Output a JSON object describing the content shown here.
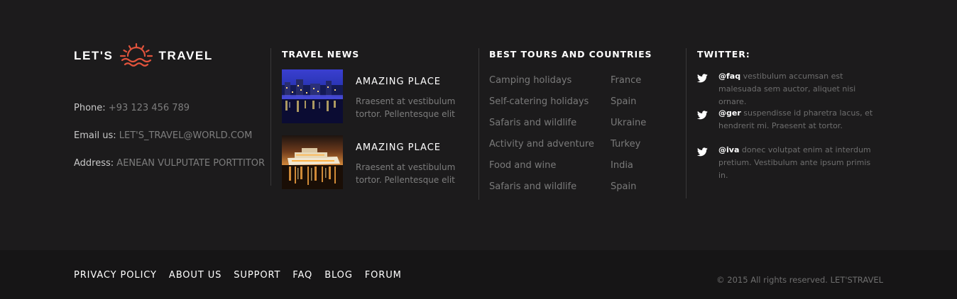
{
  "brand": {
    "left_word": "LET'S",
    "right_word": "TRAVEL",
    "logo_icon": "sun-over-waves-icon",
    "accent_color": "#e0533c"
  },
  "contact": {
    "phone_label": "Phone:",
    "phone_value": "+93 123 456 789",
    "email_label": "Email us:",
    "email_value": "LET'S_TRAVEL@WORLD.COM",
    "address_label": "Address:",
    "address_value": "AENEAN VULPUTATE PORTTITOR"
  },
  "news": {
    "title": "TRAVEL NEWS",
    "items": [
      {
        "heading": "AMAZING PLACE",
        "text": "Rraesent at vestibulum tortor. Pellentesque elit"
      },
      {
        "heading": "AMAZING PLACE",
        "text": "Rraesent at vestibulum tortor. Pellentesque elit"
      }
    ]
  },
  "tours": {
    "title": "BEST TOURS AND COUNTRIES",
    "tours": [
      "Camping holidays",
      "Self-catering holidays",
      "Safaris and wildlife",
      "Activity and adventure",
      "Food and wine",
      "Safaris and wildlife"
    ],
    "countries": [
      "France",
      "Spain",
      "Ukraine",
      "Turkey",
      "India",
      "Spain"
    ]
  },
  "twitter": {
    "title": "TWITTER:",
    "icon": "twitter-bird-icon",
    "tweets": [
      {
        "user": "@faq",
        "text": " vestibulum accumsan est malesuada sem auctor, aliquet nisi ornare."
      },
      {
        "user": "@ger",
        "text": " suspendisse id pharetra lacus, et hendrerit mi. Praesent at tortor."
      },
      {
        "user": "@iva",
        "text": " donec volutpat enim at interdum pretium. Vestibulum ante ipsum primis in."
      }
    ]
  },
  "bottom_nav": [
    "PRIVACY POLICY",
    "ABOUT US",
    "SUPPORT",
    "FAQ",
    "BLOG",
    "FORUM"
  ],
  "copyright": "© 2015 All rights reserved. LET'STRAVEL"
}
